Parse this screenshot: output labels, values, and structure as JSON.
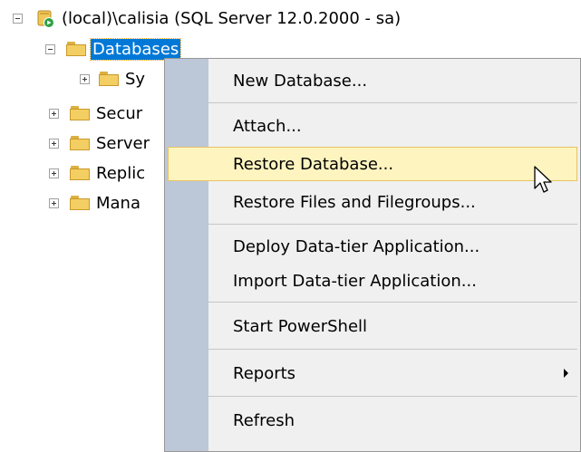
{
  "tree": {
    "server_label": "(local)\\calisia (SQL Server 12.0.2000 - sa)",
    "databases_label": "Databases",
    "children": [
      {
        "label": "Sy"
      },
      {
        "label": "Secur"
      },
      {
        "label": "Server"
      },
      {
        "label": "Replic"
      },
      {
        "label": "Mana"
      }
    ]
  },
  "context_menu": {
    "items": [
      {
        "label": "New Database..."
      },
      {
        "label": "Attach..."
      },
      {
        "label": "Restore Database..."
      },
      {
        "label": "Restore Files and Filegroups..."
      },
      {
        "label": "Deploy Data-tier Application..."
      },
      {
        "label": "Import Data-tier Application..."
      },
      {
        "label": "Start PowerShell"
      },
      {
        "label": "Reports"
      },
      {
        "label": "Refresh"
      }
    ],
    "highlighted_item": "Restore Database...",
    "colors": {
      "gutter": "#bcc7d8",
      "highlight": "#fdf4bf",
      "selection": "#0078d7"
    }
  }
}
